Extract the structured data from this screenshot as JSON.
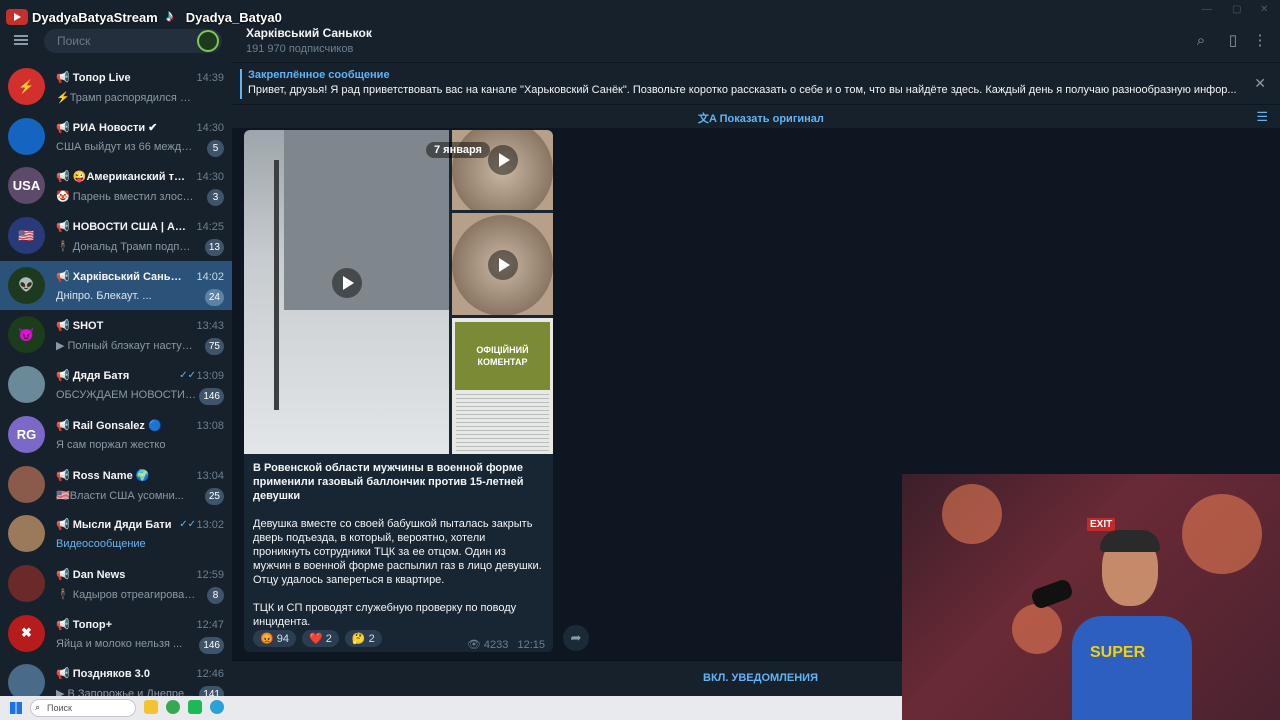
{
  "overlay": {
    "youtube_name": "DyadyaBatyaStream",
    "tiktok_name": "Dyadya_Batya0"
  },
  "sidebar": {
    "search_placeholder": "Поиск",
    "chats": [
      {
        "name": "Топор Live",
        "time": "14:39",
        "preview": "⚡Трамп распорядился о выхо...",
        "badge": "",
        "avatar_color": "#d32f2f",
        "avatar_text": "⚡"
      },
      {
        "name": "РИА Новости ✔",
        "time": "14:30",
        "preview": "США выйдут из 66 междуна...",
        "badge": "5",
        "avatar_color": "#1565c0",
        "avatar_text": ""
      },
      {
        "name": "😜Американский тре...",
        "time": "14:30",
        "preview": "🤡 Парень вместил злость...",
        "badge": "3",
        "avatar_color": "#5d4a6a",
        "avatar_text": "USA"
      },
      {
        "name": "НОВОСТИ США | АМЕ...",
        "time": "14:25",
        "preview": "🕴 Дональд Трамп подпис...",
        "badge": "13",
        "avatar_color": "#283a7a",
        "avatar_text": "🇺🇸"
      },
      {
        "name": "Харківський Санькок",
        "time": "14:02",
        "preview": "Дніпро. Блекаут. ...",
        "badge": "24",
        "avatar_color": "#1e3a1e",
        "avatar_text": "👽"
      },
      {
        "name": "SHOT",
        "time": "13:43",
        "preview": "▶ Полный блэкаут наступ...",
        "badge": "75",
        "avatar_color": "#1b3d1b",
        "avatar_text": "😈"
      },
      {
        "name": "Дядя Батя",
        "time": "13:09",
        "preview": "ОБСУЖДАЕМ НОВОСТИ В ПРЯМ...",
        "badge": "146",
        "avatar_color": "#6a8a9a",
        "avatar_text": "",
        "ticks": true
      },
      {
        "name": "Rail Gonsalez 🔵",
        "time": "13:08",
        "preview": "Я сам поржал жестко",
        "badge": "",
        "avatar_color": "#7b68c8",
        "avatar_text": "RG"
      },
      {
        "name": "Ross Name 🌍",
        "time": "13:04",
        "preview": "🇺🇸Власти США усомни...",
        "badge": "25",
        "avatar_color": "#8a5a4a",
        "avatar_text": ""
      },
      {
        "name": "Мысли Дяди Бати",
        "time": "13:02",
        "preview": "Видеосообщение",
        "badge": "",
        "avatar_color": "#9a7a5a",
        "avatar_text": "",
        "ticks": true,
        "blue": true
      },
      {
        "name": "Dan News",
        "time": "12:59",
        "preview": "🕴 Кадыров отреагировал ...",
        "badge": "8",
        "avatar_color": "#6a2a2a",
        "avatar_text": ""
      },
      {
        "name": "Топор+",
        "time": "12:47",
        "preview": "Яйца и молоко нельзя ...",
        "badge": "146",
        "avatar_color": "#b71c1c",
        "avatar_text": "✖"
      },
      {
        "name": "Поздняков 3.0",
        "time": "12:46",
        "preview": "▶ В Запорожье и Днепре...",
        "badge": "141",
        "avatar_color": "#4a6a8a",
        "avatar_text": ""
      }
    ]
  },
  "header": {
    "title": "Харківський Санькок",
    "subscribers": "191 970 подписчиков"
  },
  "pinned": {
    "title": "Закреплённое сообщение",
    "text": "Привет, друзья! Я рад приветствовать вас на канале \"Харьковский Санёк\". Позвольте коротко рассказать о себе и о том, что вы найдёте здесь.  Каждый день я получаю разнообразную инфор..."
  },
  "translate": {
    "label": "Показать оригинал"
  },
  "message": {
    "date": "7 января",
    "official_label": "ОФІЦІЙНИЙ КОМЕНТАР",
    "headline": "В Ровенской области мужчины в военной форме применили газовый баллончик против 15-летней девушки",
    "body": "Девушка вместе со своей бабушкой пыталась закрыть дверь подъезда, в который, вероятно, хотели проникнуть сотрудники ТЦК за ее отцом. Один из мужчин в военной форме распылил газ в лицо девушки. Отцу удалось запереться в квартире.",
    "body2": "ТЦК и СП проводят служебную проверку по поводу инцидента.",
    "reactions": [
      {
        "emoji": "😡",
        "count": "94"
      },
      {
        "emoji": "❤️",
        "count": "2"
      },
      {
        "emoji": "🤔",
        "count": "2"
      }
    ],
    "views": "4233",
    "time": "12:15"
  },
  "notifications": {
    "label": "ВКЛ. УВЕДОМЛЕНИЯ"
  },
  "webcam": {
    "exit_sign": "EXIT",
    "shirt_text": "SUPER"
  },
  "taskbar": {
    "search_label": "Поиск"
  }
}
